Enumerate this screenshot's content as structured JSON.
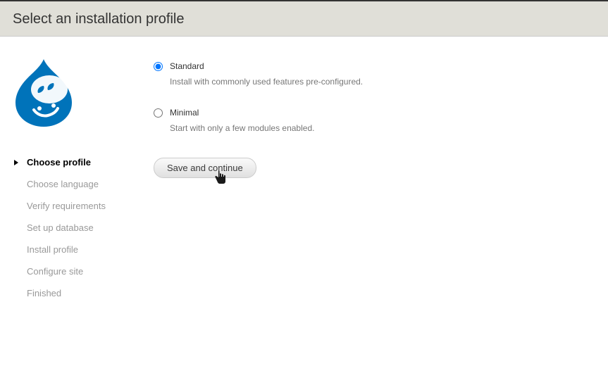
{
  "header": {
    "title": "Select an installation profile"
  },
  "sidebar": {
    "steps": [
      {
        "label": "Choose profile",
        "active": true
      },
      {
        "label": "Choose language",
        "active": false
      },
      {
        "label": "Verify requirements",
        "active": false
      },
      {
        "label": "Set up database",
        "active": false
      },
      {
        "label": "Install profile",
        "active": false
      },
      {
        "label": "Configure site",
        "active": false
      },
      {
        "label": "Finished",
        "active": false
      }
    ]
  },
  "main": {
    "options": [
      {
        "label": "Standard",
        "desc": "Install with commonly used features pre-configured.",
        "checked": true
      },
      {
        "label": "Minimal",
        "desc": "Start with only a few modules enabled.",
        "checked": false
      }
    ],
    "submit_label": "Save and continue"
  },
  "logo": {
    "name": "drupal-logo"
  },
  "cursor": {
    "name": "pointer-cursor"
  }
}
